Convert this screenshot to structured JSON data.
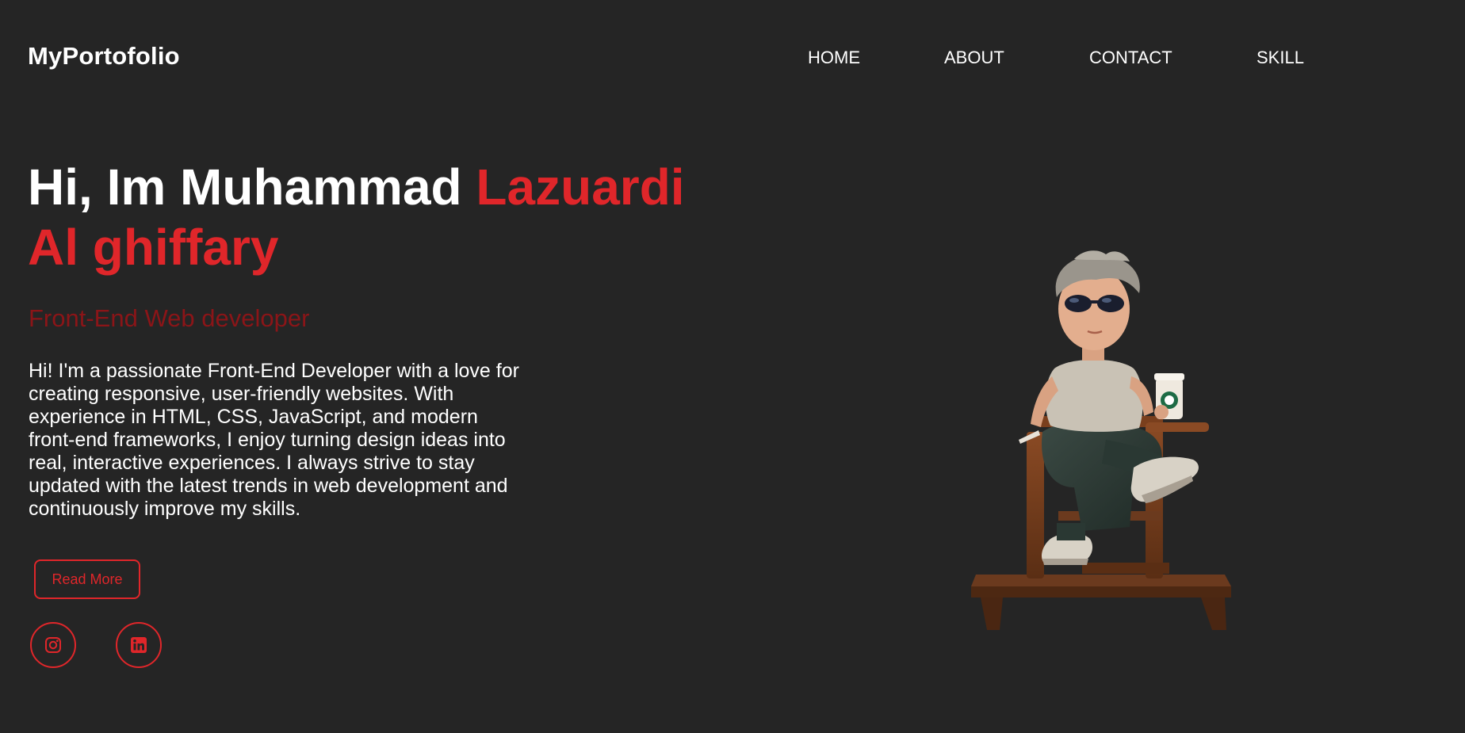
{
  "header": {
    "logo": "MyPortofolio",
    "nav": [
      "HOME",
      "ABOUT",
      "CONTACT",
      "SKILL"
    ]
  },
  "hero": {
    "headline_white": "Hi, Im Muhammad ",
    "headline_accent": "Lazuardi Al ghiffary",
    "role": "Front-End Web developer",
    "bio": "Hi! I'm a passionate Front-End Developer with a love for creating responsive, user-friendly websites. With experience in HTML, CSS, JavaScript, and modern front-end frameworks, I enjoy turning design ideas into real, interactive experiences. I always strive to stay updated with the latest trends in web development and continuously improve my skills.",
    "cta": "Read More"
  },
  "social": [
    {
      "icon": "instagram-icon"
    },
    {
      "icon": "linkedin-icon"
    }
  ],
  "colors": {
    "background": "#252525",
    "accent": "#e0262a",
    "accent_dark": "#8b1518",
    "text": "#ffffff"
  }
}
